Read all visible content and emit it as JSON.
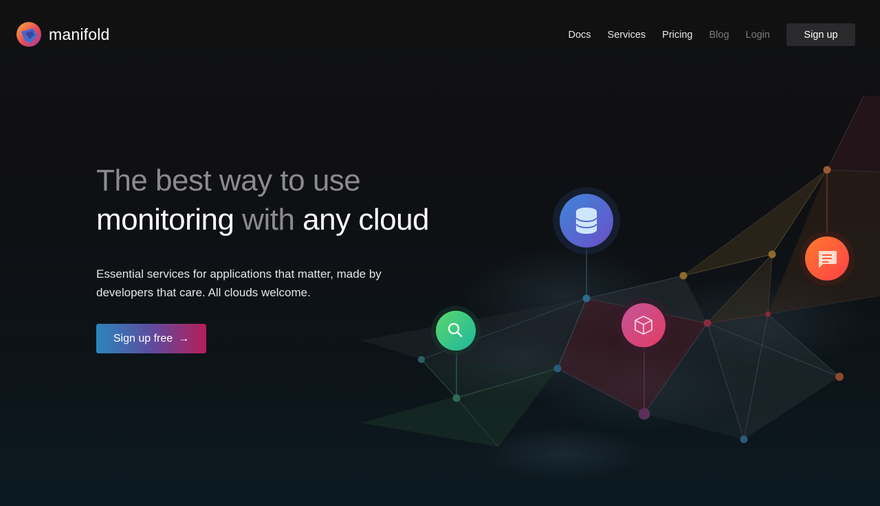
{
  "brand": {
    "name": "manifold",
    "colors": [
      "#f2a33a",
      "#e0415e",
      "#4062d8",
      "#1e8bd1"
    ]
  },
  "nav": {
    "items": [
      {
        "label": "Docs",
        "dim": false
      },
      {
        "label": "Services",
        "dim": false
      },
      {
        "label": "Pricing",
        "dim": false
      },
      {
        "label": "Blog",
        "dim": true
      },
      {
        "label": "Login",
        "dim": true
      }
    ],
    "signup_label": "Sign up"
  },
  "hero": {
    "title_line1": "The best way to use",
    "title_word1": "monitoring",
    "title_word2": "with",
    "title_word3": "any cloud",
    "subtitle": "Essential services for applications that matter, made by developers that care. All clouds welcome.",
    "cta_label": "Sign up free",
    "cta_arrow": "→"
  },
  "illustration": {
    "nodes": [
      {
        "name": "database-node",
        "icon": "database-icon",
        "color": "#5468d6"
      },
      {
        "name": "search-node",
        "icon": "search-icon",
        "color": "#35c98a"
      },
      {
        "name": "package-node",
        "icon": "package-icon",
        "color": "#d9477a"
      },
      {
        "name": "chat-node",
        "icon": "chat-icon",
        "color": "#ff5a35"
      }
    ]
  }
}
